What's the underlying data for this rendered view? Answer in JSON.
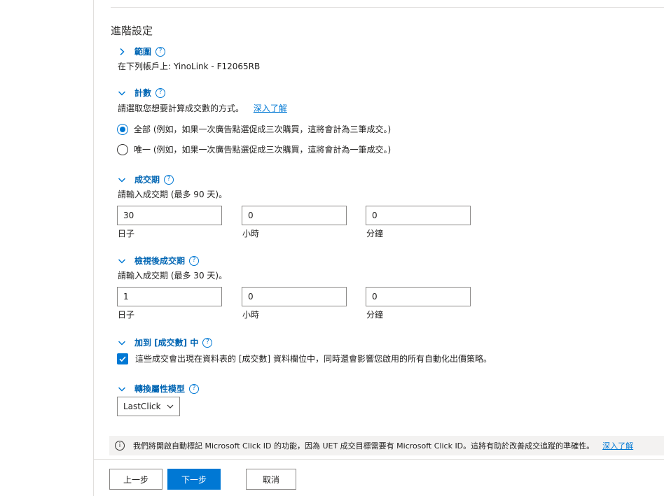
{
  "page": {
    "section_title": "進階設定"
  },
  "scope": {
    "header": "範圍",
    "help": "?",
    "desc": "在下列帳戶上: YinoLink - F12065RB"
  },
  "count": {
    "header": "計數",
    "help": "?",
    "desc": "請選取您想要計算成交數的方式。",
    "learn_more": "深入了解",
    "options": [
      {
        "label": "全部 (例如，如果一次廣告點選促成三次購買，這將會計為三筆成交。)",
        "selected": true
      },
      {
        "label": "唯一 (例如，如果一次廣告點選促成三次購買，這將會計為一筆成交。)",
        "selected": false
      }
    ]
  },
  "conversion_window": {
    "header": "成交期",
    "help": "?",
    "desc": "請輸入成交期 (最多 90 天)。",
    "days_value": "30",
    "hours_value": "0",
    "minutes_value": "0",
    "days_label": "日子",
    "hours_label": "小時",
    "minutes_label": "分鐘"
  },
  "view_through_window": {
    "header": "檢視後成交期",
    "help": "?",
    "desc": "請輸入成交期 (最多 30 天)。",
    "days_value": "1",
    "hours_value": "0",
    "minutes_value": "0",
    "days_label": "日子",
    "hours_label": "小時",
    "minutes_label": "分鐘"
  },
  "include_conversions": {
    "header": "加到 [成交數] 中",
    "help": "?",
    "checked": true,
    "label": "這些成交會出現在資料表的 [成交數] 資料欄位中，同時還會影響您啟用的所有自動化出價策略。"
  },
  "attribution": {
    "header": "轉換屬性模型",
    "help": "?",
    "selected": "LastClick"
  },
  "info_bar": {
    "icon_text": "i",
    "text": "我們將開啟自動標記 Microsoft Click ID 的功能，因為 UET 成交目標需要有 Microsoft Click ID。這將有助於改善成交追蹤的準確性。",
    "learn_more": "深入了解"
  },
  "footer": {
    "back_label": "上一步",
    "next_label": "下一步",
    "cancel_label": "取消"
  },
  "colors": {
    "accent": "#0078d4",
    "header_text": "#0065b3",
    "border": "#8a8886"
  },
  "icons": {
    "collapsed": "chevron-right-icon",
    "expanded": "chevron-down-icon",
    "help": "help-circle-icon",
    "info": "info-circle-icon",
    "check": "checkmark-icon"
  }
}
